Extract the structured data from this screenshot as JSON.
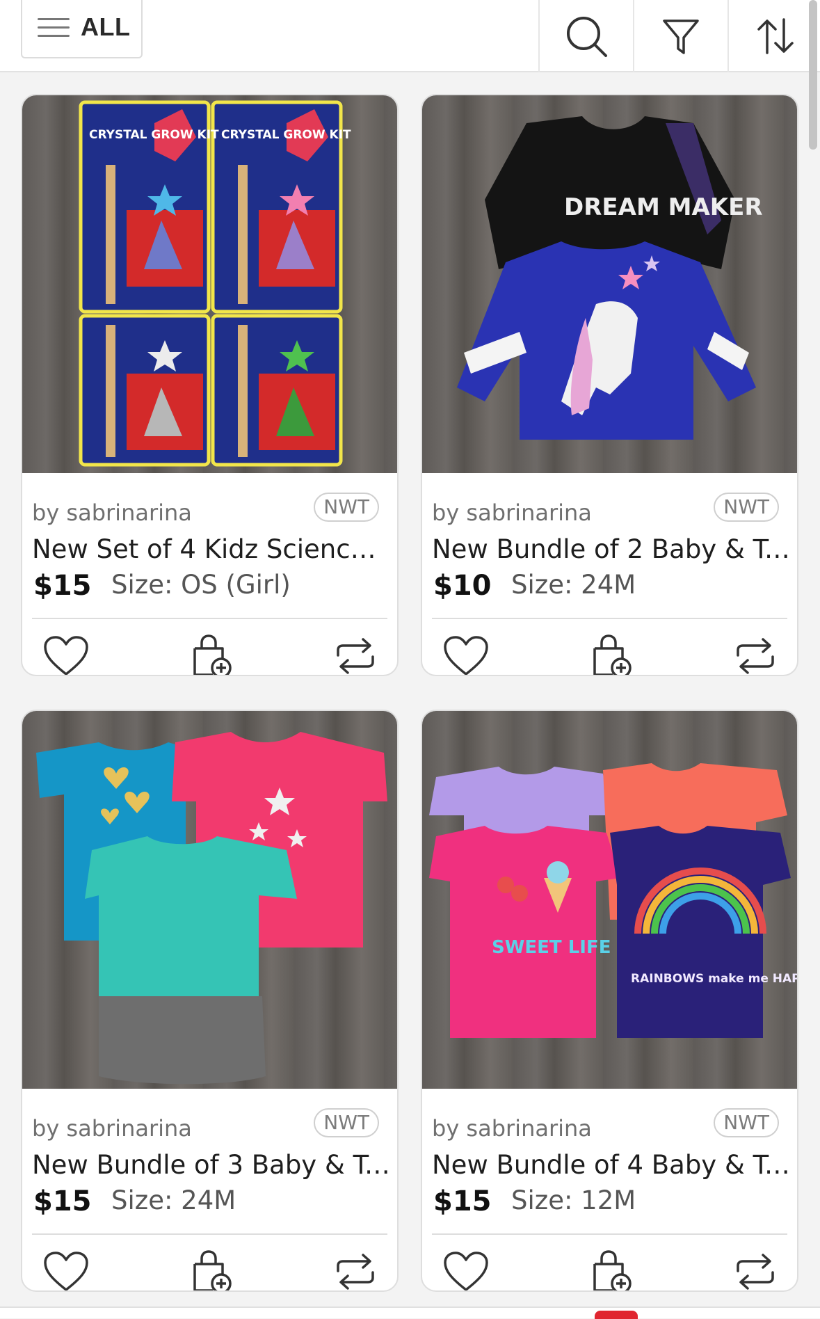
{
  "toolbar": {
    "all_label": "ALL",
    "icons": [
      "menu-icon",
      "search-icon",
      "filter-icon",
      "sort-icon"
    ]
  },
  "listings": [
    {
      "seller": "by sabrinarina",
      "badge": "NWT",
      "title": "New Set of 4 Kidz Science...",
      "price": "$15",
      "size": "Size: OS (Girl)"
    },
    {
      "seller": "by sabrinarina",
      "badge": "NWT",
      "title": "New Bundle of 2 Baby & To...",
      "price": "$10",
      "size": "Size: 24M"
    },
    {
      "seller": "by sabrinarina",
      "badge": "NWT",
      "title": "New Bundle of 3 Baby & To...",
      "price": "$15",
      "size": "Size: 24M"
    },
    {
      "seller": "by sabrinarina",
      "badge": "NWT",
      "title": "New Bundle of 4 Baby & To...",
      "price": "$15",
      "size": "Size: 12M"
    }
  ],
  "photo_text": {
    "crystal": "CRYSTAL GROW KIT",
    "dream": "DREAM MAKER",
    "sweet": "SWEET LIFE",
    "rainbows": "RAINBOWS make me HAPPY"
  },
  "colors": {
    "accent_red": "#e0252f",
    "icon_stroke": "#333333"
  }
}
